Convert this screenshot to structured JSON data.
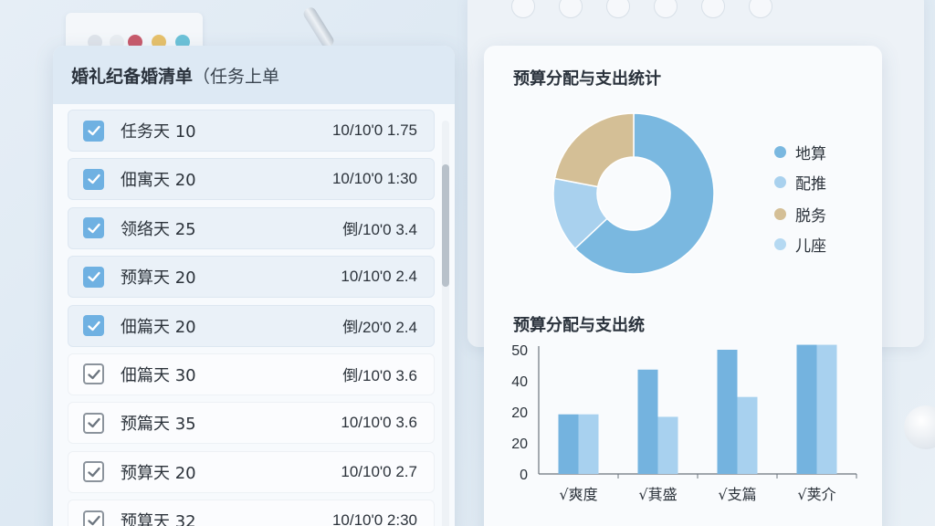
{
  "checklist": {
    "title": "婚礼纪备婚清单",
    "title_suffix": "（任务上单",
    "tasks": [
      {
        "name": "任务天 10",
        "date": "10/10'0 1.75",
        "checked": true
      },
      {
        "name": "佃寓天 20",
        "date": "10/10'0 1:30",
        "checked": true
      },
      {
        "name": "领络天 25",
        "date": "倒/10'0 3.4",
        "checked": true
      },
      {
        "name": "预算天 20",
        "date": "10/10'0 2.4",
        "checked": true
      },
      {
        "name": "佃篇天 20",
        "date": "倒/20'0 2.4",
        "checked": true
      },
      {
        "name": "佃篇天 30",
        "date": "倒/10'0 3.6",
        "checked": false
      },
      {
        "name": "预篇天 35",
        "date": "10/10'0 3.6",
        "checked": false
      },
      {
        "name": "预算天 20",
        "date": "10/10'0 2.7",
        "checked": false
      },
      {
        "name": "预算天 32",
        "date": "10/10'0 2:30",
        "checked": false
      }
    ]
  },
  "stats": {
    "title": "预算分配与支出统计",
    "bar_title": "预算分配与支出统"
  },
  "chart_data": [
    {
      "type": "pie",
      "donut": true,
      "title": "预算分配与支出统计",
      "slices": [
        {
          "label": "地算",
          "value": 63,
          "color": "#7ab8e0"
        },
        {
          "label": "配推",
          "value": 15,
          "color": "#a9d1ee"
        },
        {
          "label": "脱务",
          "value": 22,
          "color": "#d4bf96"
        },
        {
          "label": "儿座",
          "value": 0,
          "color": "#b5d9f2"
        }
      ],
      "legend": "right"
    },
    {
      "type": "bar",
      "title": "预算分配与支出统",
      "categories": [
        "√爽度",
        "√萁盛",
        "√支篇",
        "√荚介"
      ],
      "series": [
        {
          "values": [
            24,
            42,
            50,
            52
          ],
          "color": "#74b3df"
        },
        {
          "values": [
            24,
            23,
            31,
            52
          ],
          "color": "#a8d1ef"
        }
      ],
      "y_tick_labels": [
        "0",
        "20",
        "20",
        "40",
        "50"
      ],
      "ylim": [
        0,
        50
      ]
    }
  ]
}
